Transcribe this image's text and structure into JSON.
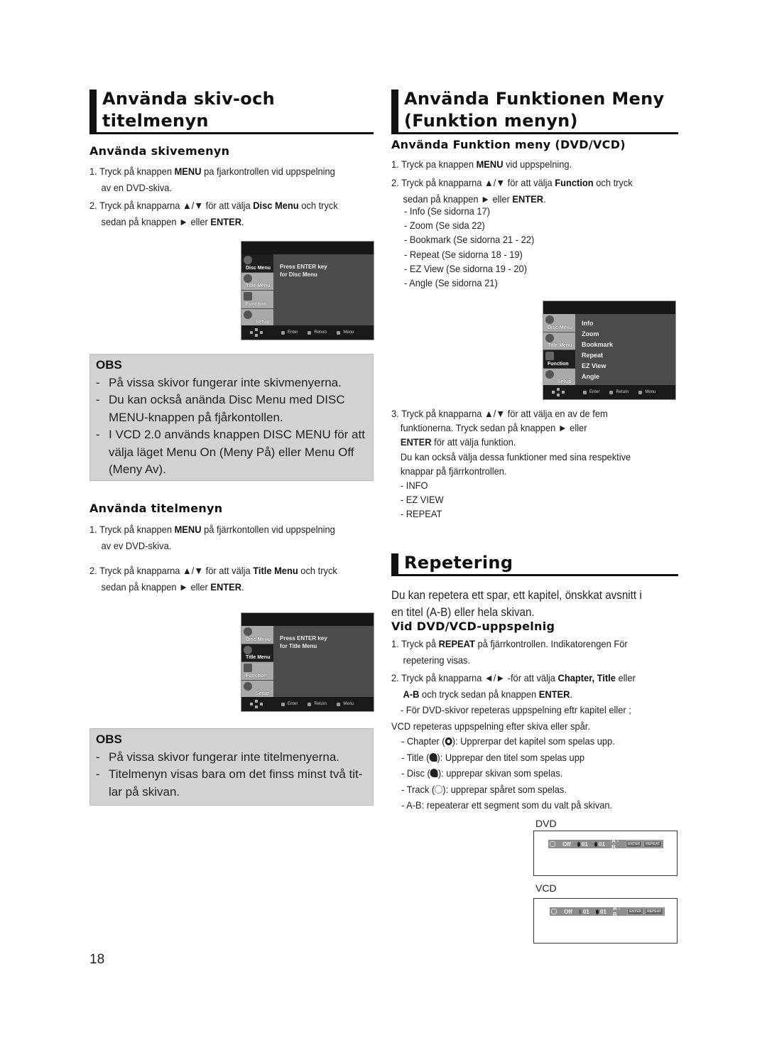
{
  "page_number": "18",
  "left": {
    "section1": {
      "title_line1": "Använda skiv-och",
      "title_line2": "titelmenyn"
    },
    "disc_menu": {
      "heading": "Använda skivemenyn",
      "step1_a": "1. Tryck på knappen ",
      "step1_bold": "MENU",
      "step1_b": " pa fjarkontrollen vid uppspelning",
      "step1_c": "av en DVD-skiva.",
      "step2_a": "2. Tryck på knapparna ▲/▼ för att välja ",
      "step2_bold": "Disc Menu",
      "step2_b": " och tryck",
      "step2_c": "sedan på knappen ► eller ",
      "step2_bold2": "ENTER",
      "step2_d": ".",
      "screen": {
        "tabs": [
          "Disc Menu",
          "Title Menu",
          "Function",
          "Setup"
        ],
        "active_tab": "Disc Menu",
        "message_line1": "Press ENTER key",
        "message_line2": "for Disc Menu",
        "footer": [
          "Enter",
          "Return",
          "Menu"
        ]
      },
      "obs": {
        "title": "OBS",
        "items": [
          "På vissa skivor fungerar inte skivmenyerna.",
          "Du kan också anända Disc Menu med DISC MENU-knappen på fjårkontollen.",
          "I VCD 2.0 används knappen DISC MENU för att välja läget Menu On (Meny På) eller Menu Off (Meny Av)."
        ]
      }
    },
    "title_menu": {
      "heading": "Använda titelmenyn",
      "step1_a": "1. Tryck på knappen ",
      "step1_bold": "MENU",
      "step1_b": " på fjärrkontollen vid uppspelning",
      "step1_c": "av ev DVD-skiva.",
      "step2_a": "2. Tryck på knapparna ▲/▼ för att välja ",
      "step2_bold": "Title Menu",
      "step2_b": " och tryck",
      "step2_c": "sedan på knappen ► eller ",
      "step2_bold2": "ENTER",
      "step2_d": ".",
      "screen": {
        "tabs": [
          "Disc Menu",
          "Title Menu",
          "Function",
          "Setup"
        ],
        "active_tab": "Title Menu",
        "message_line1": "Press ENTER key",
        "message_line2": "for Title Menu",
        "footer": [
          "Enter",
          "Return",
          "Menu"
        ]
      },
      "obs": {
        "title": "OBS",
        "items": [
          "På vissa skivor fungerar inte titelmenyerna.",
          "Titelmenyn visas bara om det finss minst två tit- lar på skivan."
        ]
      }
    }
  },
  "right": {
    "section1": {
      "title_line1": "Använda Funktionen Meny",
      "title_line2": "(Funktion menyn)"
    },
    "function_menu": {
      "heading": "Använda Funktion meny (DVD/VCD)",
      "step1_a": "1. Tryck pa knappen ",
      "step1_bold": "MENU",
      "step1_b": " vid uppspelning.",
      "step2_a": "2. Tryck på knapparna ▲/▼ för att välja ",
      "step2_bold": "Function",
      "step2_b": " och tryck",
      "step2_c": "sedan på knappen ► eller ",
      "step2_bold2": "ENTER",
      "step2_d": ".",
      "options": [
        "- Info (Se sidorna 17)",
        "- Zoom (Se sida 22)",
        "- Bookmark (Se sidorna 21 - 22)",
        "- Repeat (Se sidorna 18 - 19)",
        "- EZ View (Se sidorna 19 - 20)",
        "- Angle  (Se sidorna 21)"
      ],
      "screen": {
        "tabs": [
          "Disc Menu",
          "Title Menu",
          "Function",
          "Setup"
        ],
        "active_tab": "Function",
        "items": [
          "Info",
          "Zoom",
          "Bookmark",
          "Repeat",
          "EZ View",
          "Angle"
        ],
        "footer": [
          "Enter",
          "Return",
          "Menu"
        ]
      },
      "step3_a": "3. Tryck på knapparna ▲/▼ för att välja en av de fem",
      "step3_b": "funktionerna. Tryck sedan på knappen ► eller",
      "step3_bold": "ENTER",
      "step3_c": " för att välja funktion.",
      "step3_d": "Du kan också välja dessa funktioner med sina respektive",
      "step3_e": "knappar på fjärrkontrollen.",
      "remote_buttons": [
        "- INFO",
        "- EZ VIEW",
        "- REPEAT"
      ]
    },
    "repeat": {
      "title": "Repetering",
      "intro_line1": "Du kan repetera ett spar, ett kapitel, önskkat avsnitt i",
      "intro_line2": "en titel (A-B) eller hela skivan.",
      "heading": "Vid DVD/VCD-uppspelnig",
      "step1_a": "1. Tryck på ",
      "step1_bold": "REPEAT",
      "step1_b": " på fjärrkontrollen. Indikatorengen För",
      "step1_c": "repetering visas.",
      "step2_a": "2. Tryck på knapparna ◄/► -för att välja ",
      "step2_bold": "Chapter, Title",
      "step2_b": " eller",
      "step2_bold2": "A-B",
      "step2_c": " och tryck sedan på knappen ",
      "step2_bold3": "ENTER",
      "step2_d": ".",
      "note_line1": "- För DVD-skivor repeteras uppspelning eftr kapitel eller ;",
      "note_line2": "VCD repeteras uppspelning efter skiva eller spår.",
      "modes": [
        {
          "pre": "- Chapter (",
          "icon": "chapter-repeat-icon",
          "post": "): Upprerpar det kapitel som spelas upp."
        },
        {
          "pre": "- Title (",
          "icon": "title-repeat-icon",
          "post": "): Upprepar den titel som spelas upp"
        },
        {
          "pre": "- Disc (",
          "icon": "disc-repeat-icon",
          "post": "): upprepar skivan som spelas."
        },
        {
          "pre": "- Track (",
          "icon": "track-repeat-icon",
          "post": "): upprepar spåret som spelas."
        },
        {
          "pre": "- A-B: repeaterar ett segment som du valt på skivan.",
          "icon": "",
          "post": ""
        }
      ],
      "dvd_panel": {
        "label": "DVD",
        "status": "Off",
        "chapter": "01",
        "title": "01",
        "ab": "A - B",
        "btn1": "ENTER",
        "btn2": "REPEAT"
      },
      "vcd_panel": {
        "label": "VCD",
        "status": "Off",
        "track": "01",
        "disc": "01",
        "ab": "A - B",
        "btn1": "ENTER",
        "btn2": "REPEAT"
      }
    }
  }
}
